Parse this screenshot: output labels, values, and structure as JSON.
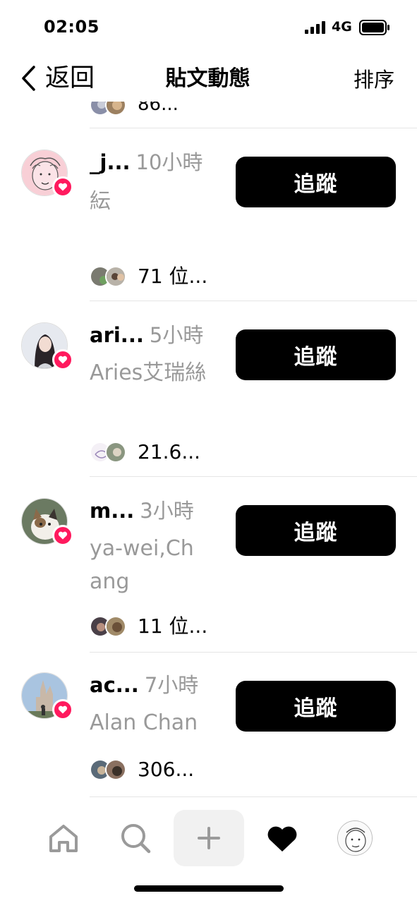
{
  "status_bar": {
    "time": "02:05",
    "network": "4G",
    "icons": [
      "signal-icon",
      "battery-icon"
    ]
  },
  "nav": {
    "back_label": "返回",
    "title": "貼文動態",
    "sort_label": "排序"
  },
  "partial_row": {
    "likes": "86..."
  },
  "rows": [
    {
      "username": "_j...",
      "time": "10小時",
      "display_name": "紜",
      "follow_label": "追蹤",
      "likes": "71 位...",
      "avatar": "sketch-face-avatar"
    },
    {
      "username": "ari...",
      "time": "5小時",
      "display_name": "Aries艾瑞絲",
      "follow_label": "追蹤",
      "likes": "21.6...",
      "avatar": "woman-portrait-avatar"
    },
    {
      "username": "m...",
      "time": "3小時",
      "display_name": "ya-wei,Chang",
      "follow_label": "追蹤",
      "likes": "11 位...",
      "avatar": "cat-avatar"
    },
    {
      "username": "ac...",
      "time": "7小時",
      "display_name": "Alan Chan",
      "follow_label": "追蹤",
      "likes": "306...",
      "avatar": "castle-photo-avatar"
    }
  ],
  "tab_bar": {
    "tabs": [
      "home-icon",
      "search-icon",
      "plus-icon",
      "heart-icon",
      "profile-avatar"
    ],
    "active": "heart-icon"
  },
  "colors": {
    "accent": "#ff1a5e",
    "secondary_text": "#999999",
    "button_bg": "#000000"
  }
}
